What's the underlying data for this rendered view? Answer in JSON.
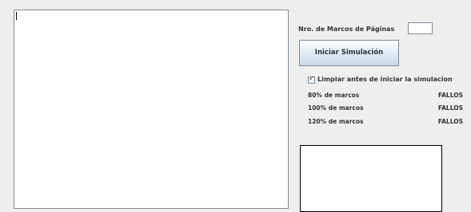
{
  "simulation": {
    "output_text": "",
    "frames_label": "Nro. de Marcos de Páginas",
    "frames_value": "",
    "start_button_label": "Iniciar Simulación",
    "clear_before_start": {
      "label": "Limpiar antes de iniciar la simulacion",
      "checked": true
    },
    "results": [
      {
        "label": "80% de marcos",
        "value": "FALLOS"
      },
      {
        "label": "100% de marcos",
        "value": "FALLOS"
      },
      {
        "label": "120% de marcos",
        "value": "FALLOS"
      }
    ],
    "secondary_output_text": ""
  }
}
